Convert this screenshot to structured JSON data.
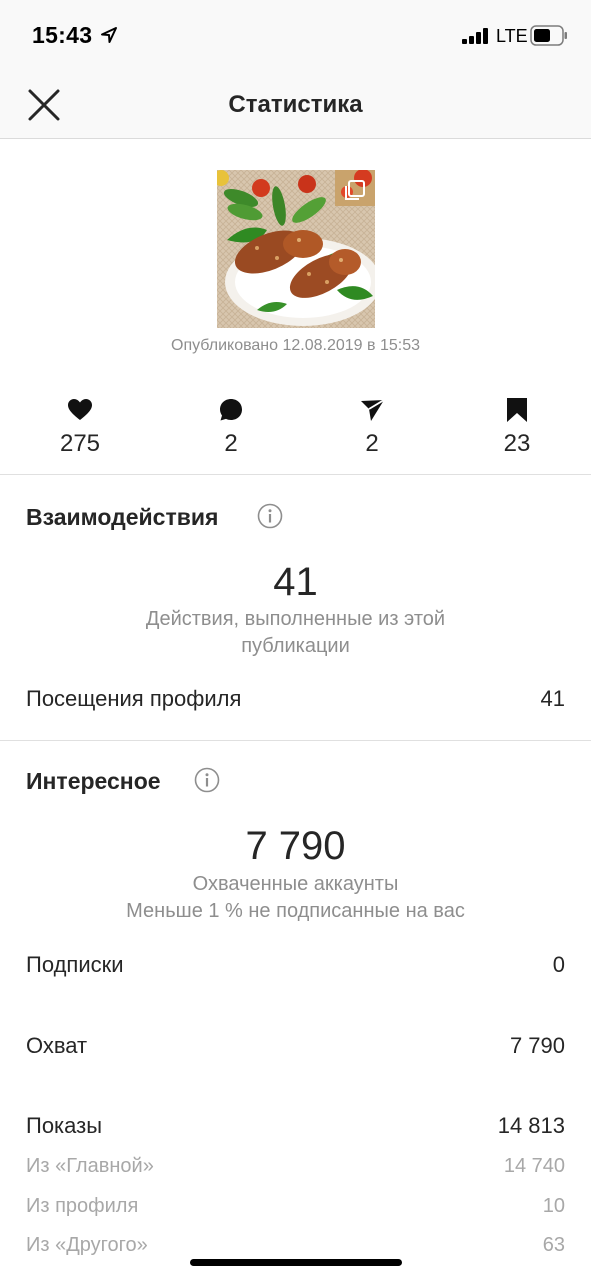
{
  "status_bar": {
    "time": "15:43",
    "network": "LTE",
    "icons": [
      "location-arrow-icon",
      "signal-bars-icon",
      "battery-icon"
    ]
  },
  "nav": {
    "title": "Статистика",
    "close_icon": "close-icon"
  },
  "post": {
    "published": "Опубликовано 12.08.2019 в 15:53",
    "image_icon": "carousel-icon"
  },
  "metrics": [
    {
      "icon": "heart-icon",
      "value": "275"
    },
    {
      "icon": "comment-icon",
      "value": "2"
    },
    {
      "icon": "send-icon",
      "value": "2"
    },
    {
      "icon": "bookmark-icon",
      "value": "23"
    }
  ],
  "interactions": {
    "title": "Взаимодействия",
    "total": "41",
    "description": "Действия, выполненные из этой публикации",
    "rows": [
      {
        "label": "Посещения профиля",
        "value": "41"
      }
    ]
  },
  "discovery": {
    "title": "Интересное",
    "total": "7 790",
    "description": "Охваченные аккаунты",
    "note": "Меньше 1 % не подписанные на вас",
    "rows": [
      {
        "label": "Подписки",
        "value": "0"
      },
      {
        "label": "Охват",
        "value": "7 790"
      },
      {
        "label": "Показы",
        "value": "14 813"
      }
    ],
    "sub_rows": [
      {
        "label": "Из «Главной»",
        "value": "14 740"
      },
      {
        "label": "Из профиля",
        "value": "10"
      },
      {
        "label": "Из «Другого»",
        "value": "63"
      }
    ]
  },
  "colors": {
    "text": "#262626",
    "secondary": "#8e8e8e",
    "divider": "#e0e0e0",
    "bar_bg": "#f9f9f9"
  }
}
